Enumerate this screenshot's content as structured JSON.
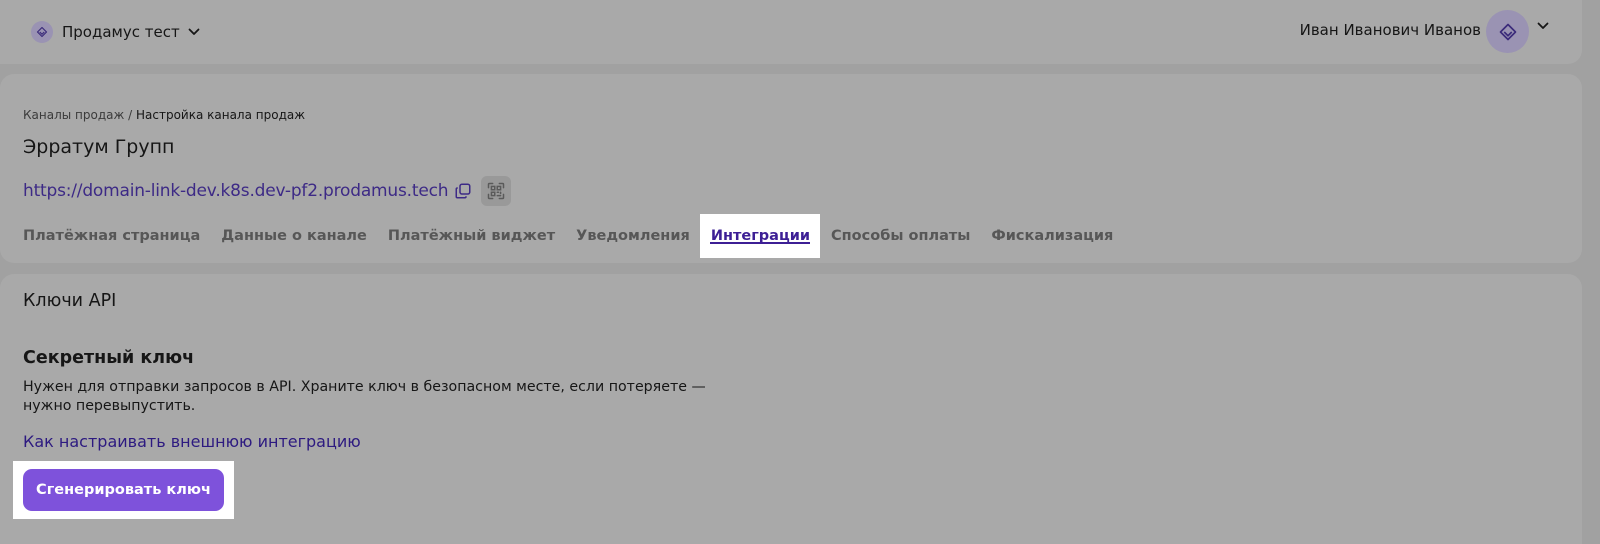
{
  "topbar": {
    "org_name": "Продамус тест",
    "user_name": "Иван Иванович Иванов"
  },
  "breadcrumb": {
    "parent": "Каналы продаж",
    "separator": "/",
    "current": "Настройка канала продаж"
  },
  "channel": {
    "title": "Эрратум Групп",
    "url": "https://domain-link-dev.k8s.dev-pf2.prodamus.tech"
  },
  "tabs": [
    {
      "label": "Платёжная страница",
      "active": false
    },
    {
      "label": "Данные о канале",
      "active": false
    },
    {
      "label": "Платёжный виджет",
      "active": false
    },
    {
      "label": "Уведомления",
      "active": false
    },
    {
      "label": "Интеграции",
      "active": true
    },
    {
      "label": "Способы оплаты",
      "active": false
    },
    {
      "label": "Фискализация",
      "active": false
    }
  ],
  "api_keys": {
    "section_title": "Ключи API",
    "secret_key_title": "Секретный ключ",
    "description_line1": "Нужен для отправки запросов в API. Храните ключ в безопасном месте, если потеряете —",
    "description_line2": "нужно перевыпустить.",
    "help_link": "Как настраивать внешнюю интеграцию",
    "generate_button": "Сгенерировать ключ"
  },
  "colors": {
    "accent": "#7e52db",
    "link": "#3d2a86",
    "active_tab": "#3d1f95",
    "overlay_bg": "#a1a1a1"
  },
  "icons": {
    "org_logo": "layers-icon",
    "org_chevron": "chevron-down-icon",
    "avatar": "layers-icon",
    "user_chevron": "chevron-down-icon",
    "copy": "copy-icon",
    "qr": "qr-code-icon"
  }
}
